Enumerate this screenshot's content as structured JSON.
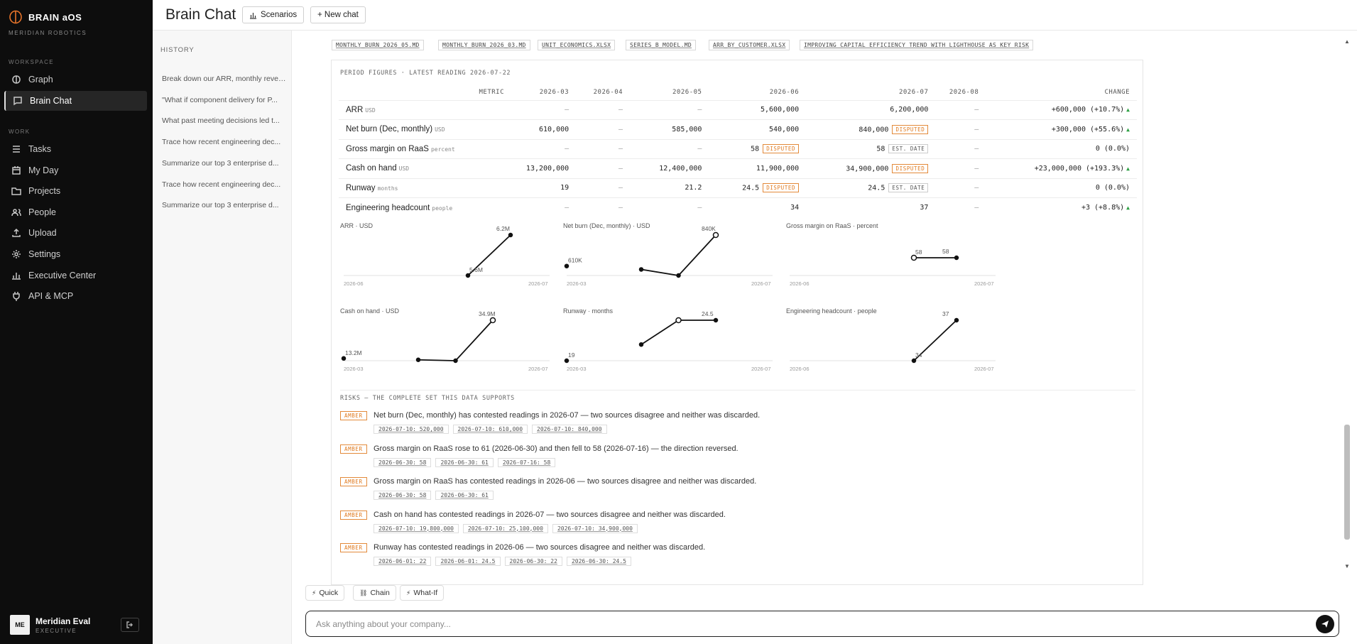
{
  "app": {
    "brand": "BRAIN aOS",
    "org": "MERIDIAN ROBOTICS"
  },
  "sidebar": {
    "workspace_label": "WORKSPACE",
    "work_label": "WORK",
    "workspace_items": [
      {
        "label": "Graph",
        "icon": "brain-icon"
      },
      {
        "label": "Brain Chat",
        "icon": "chat-icon",
        "active": true
      }
    ],
    "work_items": [
      {
        "label": "Tasks",
        "icon": "checklist-icon"
      },
      {
        "label": "My Day",
        "icon": "calendar-icon"
      },
      {
        "label": "Projects",
        "icon": "folder-icon"
      },
      {
        "label": "People",
        "icon": "people-icon"
      },
      {
        "label": "Upload",
        "icon": "upload-icon"
      },
      {
        "label": "Settings",
        "icon": "gear-icon"
      },
      {
        "label": "Executive Center",
        "icon": "bar-chart-icon"
      },
      {
        "label": "API & MCP",
        "icon": "plug-icon"
      }
    ],
    "user": {
      "initials": "ME",
      "name": "Meridian Eval",
      "role": "EXECUTIVE"
    }
  },
  "header": {
    "title": "Brain Chat",
    "scenarios_label": "Scenarios",
    "new_chat_label": "+ New chat"
  },
  "history": {
    "label": "HISTORY",
    "items": [
      "Break down our ARR, monthly revenue",
      "\"What if component delivery for P...",
      "What past meeting decisions led t...",
      "Trace how recent engineering dec...",
      "Summarize our top 3 enterprise d...",
      "Trace how recent engineering dec...",
      "Summarize our top 3 enterprise d..."
    ]
  },
  "sources": [
    "MONTHLY_BURN_2026_05.MD",
    "MONTHLY_BURN_2026_03.MD",
    "UNIT_ECONOMICS.XLSX",
    "SERIES_B_MODEL.MD",
    "ARR_BY_CUSTOMER.XLSX",
    "IMPROVING CAPITAL EFFICIENCY TREND WITH LIGHTHOUSE AS KEY RISK"
  ],
  "figures": {
    "label": "PERIOD FIGURES · LATEST READING 2026-07-22",
    "columns": [
      "METRIC",
      "2026-03",
      "2026-04",
      "2026-05",
      "2026-06",
      "2026-07",
      "2026-08",
      "CHANGE"
    ],
    "rows": [
      {
        "name": "ARR",
        "unit": "USD",
        "cells": [
          "—",
          "—",
          "—",
          "5,600,000",
          "6,200,000",
          "—"
        ],
        "badges": [
          "",
          "",
          "",
          "",
          "",
          ""
        ],
        "change": "+600,000 (+10.7%)",
        "up": true
      },
      {
        "name": "Net burn (Dec, monthly)",
        "unit": "USD",
        "cells": [
          "610,000",
          "—",
          "585,000",
          "540,000",
          "840,000",
          "—"
        ],
        "badges": [
          "",
          "",
          "",
          "",
          "DISPUTED",
          ""
        ],
        "change": "+300,000 (+55.6%)",
        "up": true
      },
      {
        "name": "Gross margin on RaaS",
        "unit": "percent",
        "cells": [
          "—",
          "—",
          "—",
          "58",
          "58",
          "—"
        ],
        "badges": [
          "",
          "",
          "",
          "DISPUTED",
          "EST. DATE",
          ""
        ],
        "change": "0 (0.0%)",
        "up": false
      },
      {
        "name": "Cash on hand",
        "unit": "USD",
        "cells": [
          "13,200,000",
          "—",
          "12,400,000",
          "11,900,000",
          "34,900,000",
          "—"
        ],
        "badges": [
          "",
          "",
          "",
          "",
          "DISPUTED",
          ""
        ],
        "change": "+23,000,000 (+193.3%)",
        "up": true
      },
      {
        "name": "Runway",
        "unit": "months",
        "cells": [
          "19",
          "—",
          "21.2",
          "24.5",
          "24.5",
          "—"
        ],
        "badges": [
          "",
          "",
          "",
          "DISPUTED",
          "EST. DATE",
          ""
        ],
        "change": "0 (0.0%)",
        "up": false
      },
      {
        "name": "Engineering headcount",
        "unit": "people",
        "cells": [
          "—",
          "—",
          "—",
          "34",
          "37",
          "—"
        ],
        "badges": [
          "",
          "",
          "",
          "",
          "",
          ""
        ],
        "change": "+3 (+8.8%)",
        "up": true
      }
    ]
  },
  "charts": [
    {
      "title": "ARR · USD",
      "x_start": "2026-06",
      "x_end": "2026-07",
      "points": [
        [
          0,
          5600000
        ],
        [
          1,
          6200000
        ]
      ],
      "n": 2,
      "first_label": "5.6M",
      "last_label": "6.2M",
      "hollow": []
    },
    {
      "title": "Net burn (Dec, monthly) · USD",
      "x_start": "2026-03",
      "x_end": "2026-07",
      "points": [
        [
          0,
          610000
        ],
        [
          2,
          585000
        ],
        [
          3,
          540000
        ],
        [
          4,
          840000
        ]
      ],
      "n": 5,
      "first_label": "610K",
      "last_label": "840K",
      "hollow": [
        4
      ]
    },
    {
      "title": "Gross margin on RaaS · percent",
      "x_start": "2026-06",
      "x_end": "2026-07",
      "points": [
        [
          0,
          58
        ],
        [
          1,
          58
        ]
      ],
      "n": 2,
      "first_label": "58",
      "last_label": "58",
      "hollow": [
        0
      ]
    },
    {
      "title": "Cash on hand · USD",
      "x_start": "2026-03",
      "x_end": "2026-07",
      "points": [
        [
          0,
          13200000
        ],
        [
          2,
          12400000
        ],
        [
          3,
          11900000
        ],
        [
          4,
          34900000
        ]
      ],
      "n": 5,
      "first_label": "13.2M",
      "last_label": "34.9M",
      "hollow": [
        4
      ]
    },
    {
      "title": "Runway · months",
      "x_start": "2026-03",
      "x_end": "2026-07",
      "points": [
        [
          0,
          19
        ],
        [
          2,
          21.2
        ],
        [
          3,
          24.5
        ],
        [
          4,
          24.5
        ]
      ],
      "n": 5,
      "first_label": "19",
      "last_label": "24.5",
      "hollow": [
        3
      ]
    },
    {
      "title": "Engineering headcount · people",
      "x_start": "2026-06",
      "x_end": "2026-07",
      "points": [
        [
          0,
          34
        ],
        [
          1,
          37
        ]
      ],
      "n": 2,
      "first_label": "34",
      "last_label": "37",
      "hollow": []
    }
  ],
  "risks": {
    "label": "RISKS — THE COMPLETE SET THIS DATA SUPPORTS",
    "level_label": "AMBER",
    "items": [
      {
        "text": "Net burn (Dec, monthly) has contested readings in 2026-07 — two sources disagree and neither was discarded.",
        "evidence": [
          "2026-07-10: 520,000",
          "2026-07-10: 610,000",
          "2026-07-10: 840,000"
        ]
      },
      {
        "text": "Gross margin on RaaS rose to 61 (2026-06-30) and then fell to 58 (2026-07-16) — the direction reversed.",
        "evidence": [
          "2026-06-30: 58",
          "2026-06-30: 61",
          "2026-07-16: 58"
        ]
      },
      {
        "text": "Gross margin on RaaS has contested readings in 2026-06 — two sources disagree and neither was discarded.",
        "evidence": [
          "2026-06-30: 58",
          "2026-06-30: 61"
        ]
      },
      {
        "text": "Cash on hand has contested readings in 2026-07 — two sources disagree and neither was discarded.",
        "evidence": [
          "2026-07-10: 19,800,000",
          "2026-07-10: 25,100,000",
          "2026-07-10: 34,900,000"
        ]
      },
      {
        "text": "Runway has contested readings in 2026-06 — two sources disagree and neither was discarded.",
        "evidence": [
          "2026-06-01: 22",
          "2026-06-01: 24.5",
          "2026-06-30: 22",
          "2026-06-30: 24.5"
        ]
      }
    ]
  },
  "composer": {
    "modes": [
      "Quick",
      "Chain",
      "What-If"
    ],
    "placeholder": "Ask anything about your company..."
  },
  "colors": {
    "sidebar_bg": "#0d0d0d",
    "disputed": "#e07a1f",
    "up": "#2ea043"
  }
}
